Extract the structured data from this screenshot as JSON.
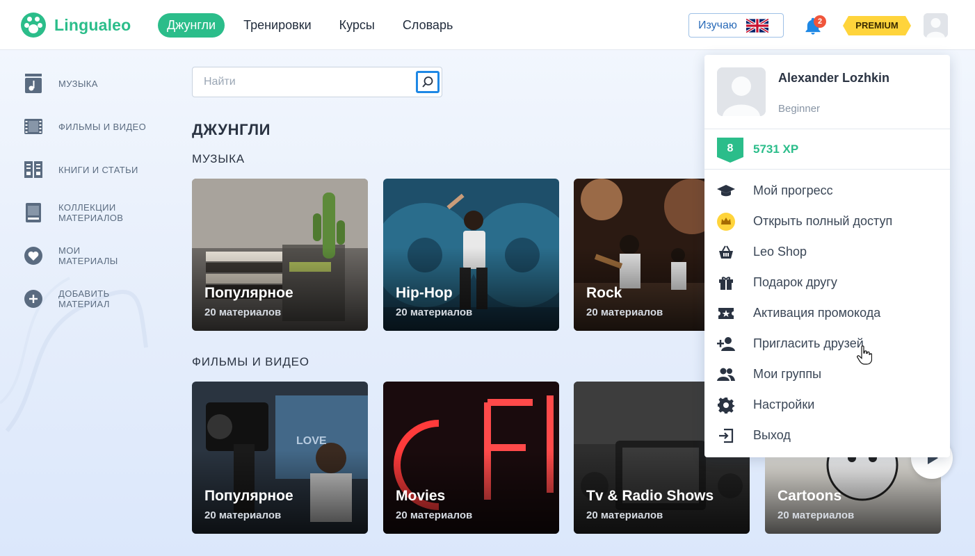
{
  "header": {
    "logo_text": "Lingualeo",
    "nav": [
      "Джунгли",
      "Тренировки",
      "Курсы",
      "Словарь"
    ],
    "learning_label": "Изучаю",
    "notification_count": "2",
    "premium_label": "PREMIUM"
  },
  "sidebar": {
    "items": [
      {
        "label": "МУЗЫКА",
        "icon": "music-icon"
      },
      {
        "label": "ФИЛЬМЫ И ВИДЕО",
        "icon": "film-icon"
      },
      {
        "label": "КНИГИ И СТАТЬИ",
        "icon": "book-icon"
      },
      {
        "label": "КОЛЛЕКЦИИ МАТЕРИАЛОВ",
        "icon": "collection-icon"
      },
      {
        "label": "МОИ МАТЕРИАЛЫ",
        "icon": "heart-icon"
      },
      {
        "label": "ДОБАВИТЬ МАТЕРИАЛ",
        "icon": "plus-icon"
      }
    ]
  },
  "search": {
    "placeholder": "Найти"
  },
  "main": {
    "title": "ДЖУНГЛИ",
    "sections": [
      {
        "title": "МУЗЫКА",
        "cards": [
          {
            "title": "Популярное",
            "subtitle": "20 материалов"
          },
          {
            "title": "Hip-Hop",
            "subtitle": "20 материалов"
          },
          {
            "title": "Rock",
            "subtitle": "20 материалов"
          }
        ]
      },
      {
        "title": "ФИЛЬМЫ И ВИДЕО",
        "cards": [
          {
            "title": "Популярное",
            "subtitle": "20 материалов"
          },
          {
            "title": "Movies",
            "subtitle": "20 материалов"
          },
          {
            "title": "Tv & Radio Shows",
            "subtitle": "20 материалов"
          },
          {
            "title": "Cartoons",
            "subtitle": "20 материалов"
          }
        ]
      }
    ]
  },
  "dropdown": {
    "user_name": "Alexander Lozhkin",
    "user_level": "Beginner",
    "level_number": "8",
    "xp_label": "5731 XP",
    "menu": [
      {
        "label": "Мой прогресс",
        "icon": "graduation-cap-icon"
      },
      {
        "label": "Открыть полный доступ",
        "icon": "crown-icon"
      },
      {
        "label": "Leo Shop",
        "icon": "basket-icon"
      },
      {
        "label": "Подарок другу",
        "icon": "gift-icon"
      },
      {
        "label": "Активация промокода",
        "icon": "ticket-icon"
      },
      {
        "label": "Пригласить друзей",
        "icon": "add-person-icon"
      },
      {
        "label": "Мои группы",
        "icon": "group-icon"
      },
      {
        "label": "Настройки",
        "icon": "gear-icon"
      },
      {
        "label": "Выход",
        "icon": "logout-icon"
      }
    ]
  },
  "colors": {
    "brand_green": "#2bbd8a",
    "link_blue": "#2a6bb8",
    "premium_yellow": "#ffd43b",
    "badge_red": "#f0553b"
  }
}
